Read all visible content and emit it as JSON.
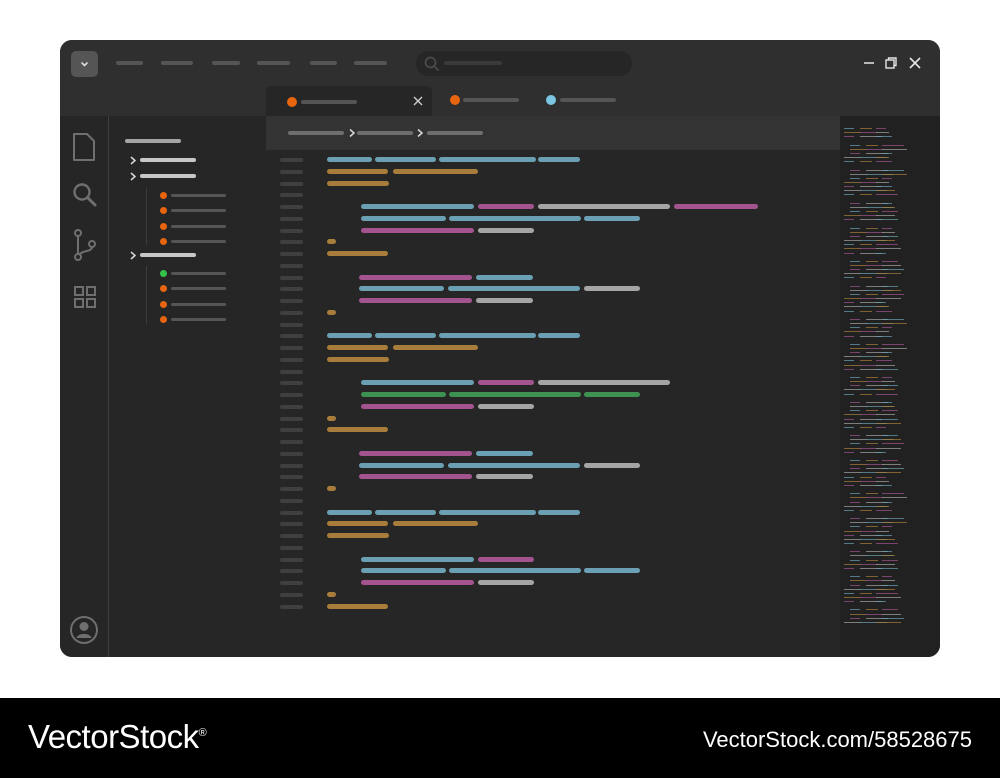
{
  "colors": {
    "page_bg": "#ffffff",
    "window_bg": "#262626",
    "titlebar_bg": "#2f2f2f",
    "tab_active_bg": "#262626",
    "breadcrumb_bg": "#333333",
    "placeholder_bar": "#555555",
    "blue": "#6b9fb3",
    "orange": "#a87d3b",
    "magenta": "#a3538e",
    "gray": "#a5a5a5",
    "green": "#3e9150",
    "dot_orange": "#e8650f",
    "dot_blue": "#7cc7e3",
    "dot_green": "#35c24a"
  },
  "icons": {
    "menu": "chevron-down-icon",
    "search": "search-icon",
    "window_controls": [
      "minimize-icon",
      "restore-icon",
      "close-icon"
    ],
    "activity": [
      "file-icon",
      "search-icon",
      "source-control-icon",
      "extensions-icon",
      "account-icon"
    ]
  },
  "tabs": [
    {
      "dot_color": "#e8650f",
      "active": true,
      "closable": true
    },
    {
      "dot_color": "#e8650f",
      "active": false
    },
    {
      "dot_color": "#7cc7e3",
      "active": false
    }
  ],
  "explorer": {
    "folders": [
      {
        "expanded": false
      },
      {
        "expanded": false,
        "files": [
          "orange",
          "orange",
          "orange",
          "orange"
        ]
      },
      {
        "expanded": true,
        "files": [
          "green",
          "orange",
          "orange",
          "orange"
        ]
      }
    ]
  },
  "watermark": {
    "brand": "VectorStock",
    "trademark": "®",
    "url": "VectorStock.com/58528675"
  }
}
